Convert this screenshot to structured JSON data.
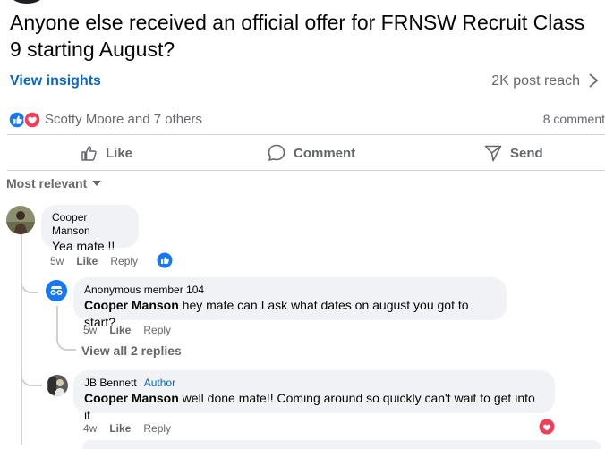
{
  "post": {
    "title": "Anyone else received an official offer for FRNSW Recruit Class 9 starting August?",
    "view_insights": "View insights",
    "reach": "2K post reach",
    "reactions_text": "Scotty Moore and 7 others",
    "comment_count": "8 comment"
  },
  "actions": {
    "like": "Like",
    "comment": "Comment",
    "send": "Send"
  },
  "sort_label": "Most relevant",
  "comments": [
    {
      "author": "Cooper Manson",
      "text": "Yea mate !!",
      "time": "5w",
      "like": "Like",
      "reply": "Reply",
      "replies": [
        {
          "author": "Anonymous member 104",
          "mention": "Cooper Manson",
          "text": " hey mate can I ask what dates on august you got to start?",
          "time": "5w",
          "like": "Like",
          "reply": "Reply"
        }
      ],
      "view_replies": "View all 2 replies"
    },
    {
      "author": "JB Bennett",
      "author_tag": "Author",
      "mention": "Cooper Manson",
      "text": " well done mate!! Coming around so quickly can't wait to get into it",
      "time": "4w",
      "like": "Like",
      "reply": "Reply"
    }
  ],
  "colors": {
    "link_blue": "#0a66c2",
    "like_blue": "#1877f2",
    "love_red": "#f33e58",
    "muted_text": "#65676b",
    "bubble_bg": "#f0f2f5"
  }
}
